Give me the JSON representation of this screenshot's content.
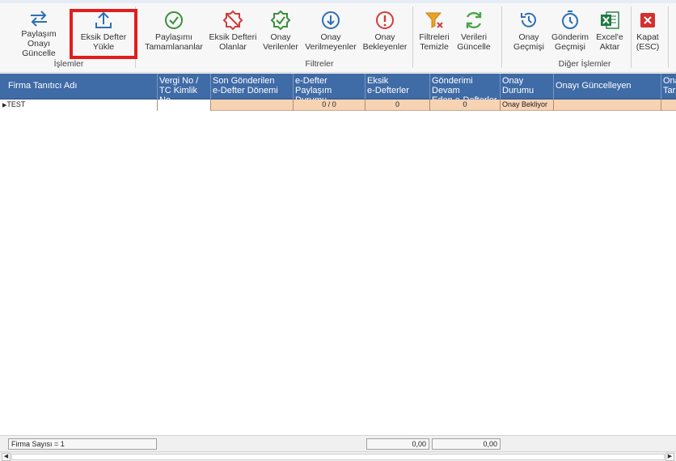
{
  "ribbon": {
    "buttons": [
      {
        "label": "Paylaşım\nOnayı Güncelle",
        "icon": "swap-arrows-icon"
      },
      {
        "label": "Eksik Defter\nYükle",
        "icon": "upload-icon"
      },
      {
        "label": "Paylaşımı\nTamamlananlar",
        "icon": "check-circle-icon"
      },
      {
        "label": "Eksik Defteri\nOlanlar",
        "icon": "missing-badge-icon"
      },
      {
        "label": "Onay\nVerilenler",
        "icon": "approved-badge-icon"
      },
      {
        "label": "Onay\nVerilmeyenler",
        "icon": "download-circle-icon"
      },
      {
        "label": "Onay\nBekleyenler",
        "icon": "alert-circle-icon"
      },
      {
        "label": "Filtreleri\nTemizle",
        "icon": "clear-filter-icon"
      },
      {
        "label": "Verileri\nGüncelle",
        "icon": "refresh-icon"
      },
      {
        "label": "Onay\nGeçmişi",
        "icon": "history-icon"
      },
      {
        "label": "Gönderim\nGeçmişi",
        "icon": "send-history-icon"
      },
      {
        "label": "Excel'e\nAktar",
        "icon": "excel-icon"
      },
      {
        "label": "Kapat\n(ESC)",
        "icon": "close-icon"
      }
    ],
    "groups": [
      "İşlemler",
      "Filtreler",
      "Diğer İşlemler"
    ]
  },
  "grid": {
    "columns": [
      "Firma Tanıtıcı Adı",
      "Vergi No /\nTC Kimlik No",
      "Son Gönderilen\ne-Defter Dönemi",
      "e-Defter Paylaşım\nDurumu",
      "Eksik\ne-Defterler",
      "Gönderimi Devam\nEden e-Defterler",
      "Onay\nDurumu",
      "Onayı Güncelleyen",
      "Ona\nTar"
    ],
    "rows": [
      {
        "firma": "TEST",
        "vergi": "",
        "son": "",
        "paylasim": "0 / 0",
        "eksik": "0",
        "devam": "0",
        "onay": "Onay Bekliyor",
        "guncelleyen": "",
        "tarih": ""
      }
    ]
  },
  "status": {
    "firma_sayisi": "Firma Sayısı = 1",
    "total1": "0,00",
    "total2": "0,00"
  },
  "colors": {
    "header_bg": "#3f6ba6",
    "row_bg": "#f7d3b4",
    "highlight": "#e21d1d"
  }
}
